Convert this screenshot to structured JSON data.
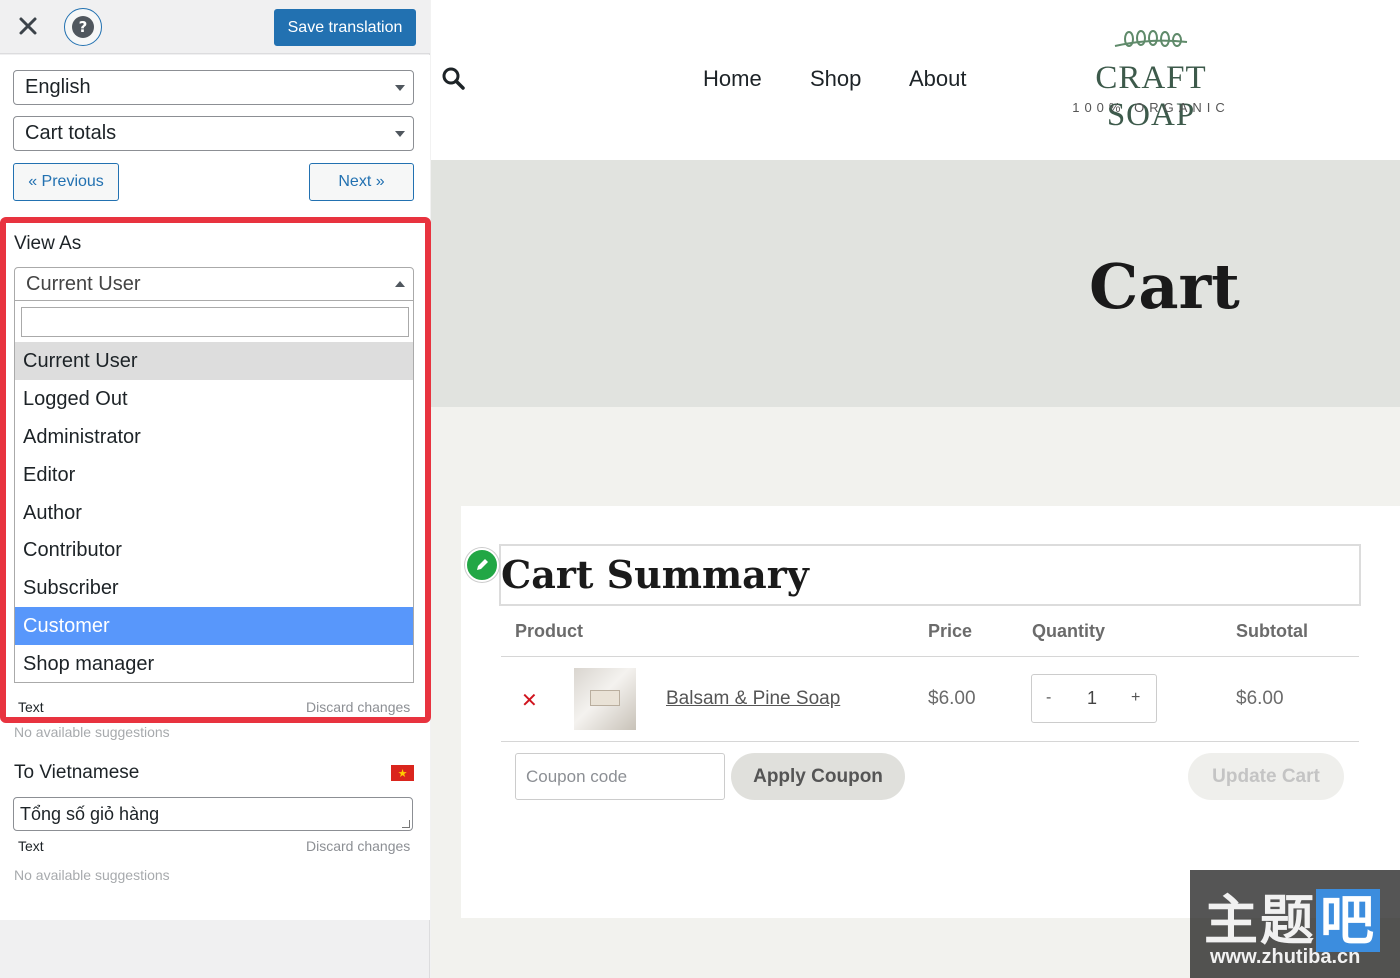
{
  "panel": {
    "save_label": "Save translation",
    "language_select": "English",
    "string_select": "Cart totals",
    "previous_label": "« Previous",
    "next_label": "Next »",
    "view_as": {
      "label": "View As",
      "selected": "Current User",
      "search_placeholder": "",
      "options": [
        "Current User",
        "Logged Out",
        "Administrator",
        "Editor",
        "Author",
        "Contributor",
        "Subscriber",
        "Customer",
        "Shop manager"
      ],
      "highlighted": "Customer"
    },
    "source_meta_left": "Text",
    "source_meta_right": "Discard changes",
    "source_suggestions": "No available suggestions",
    "to_label": "To Vietnamese",
    "translation_value": "Tổng số giỏ hàng",
    "target_meta_left": "Text",
    "target_meta_right": "Discard changes",
    "target_suggestions": "No available suggestions"
  },
  "site": {
    "nav": [
      "Home",
      "Shop",
      "About"
    ],
    "logo_title": "CRAFT SOAP",
    "logo_sub": "100% ORGANIC",
    "hero_title": "Cart",
    "summary_title": "Cart Summary",
    "columns": [
      "Product",
      "Price",
      "Quantity",
      "Subtotal"
    ],
    "row": {
      "product": "Balsam & Pine Soap",
      "price": "$6.00",
      "qty_minus": "-",
      "quantity": "1",
      "qty_plus": "+",
      "subtotal": "$6.00"
    },
    "coupon_placeholder": "Coupon code",
    "apply_label": "Apply Coupon",
    "update_label": "Update Cart"
  },
  "watermark": {
    "text_a": "主题",
    "text_b": "吧",
    "url": "www.zhutiba.cn"
  },
  "colors": {
    "accent": "#2271b1",
    "highlight": "#5897fb",
    "focus_border": "#e8333f",
    "edit_badge": "#22a745"
  }
}
